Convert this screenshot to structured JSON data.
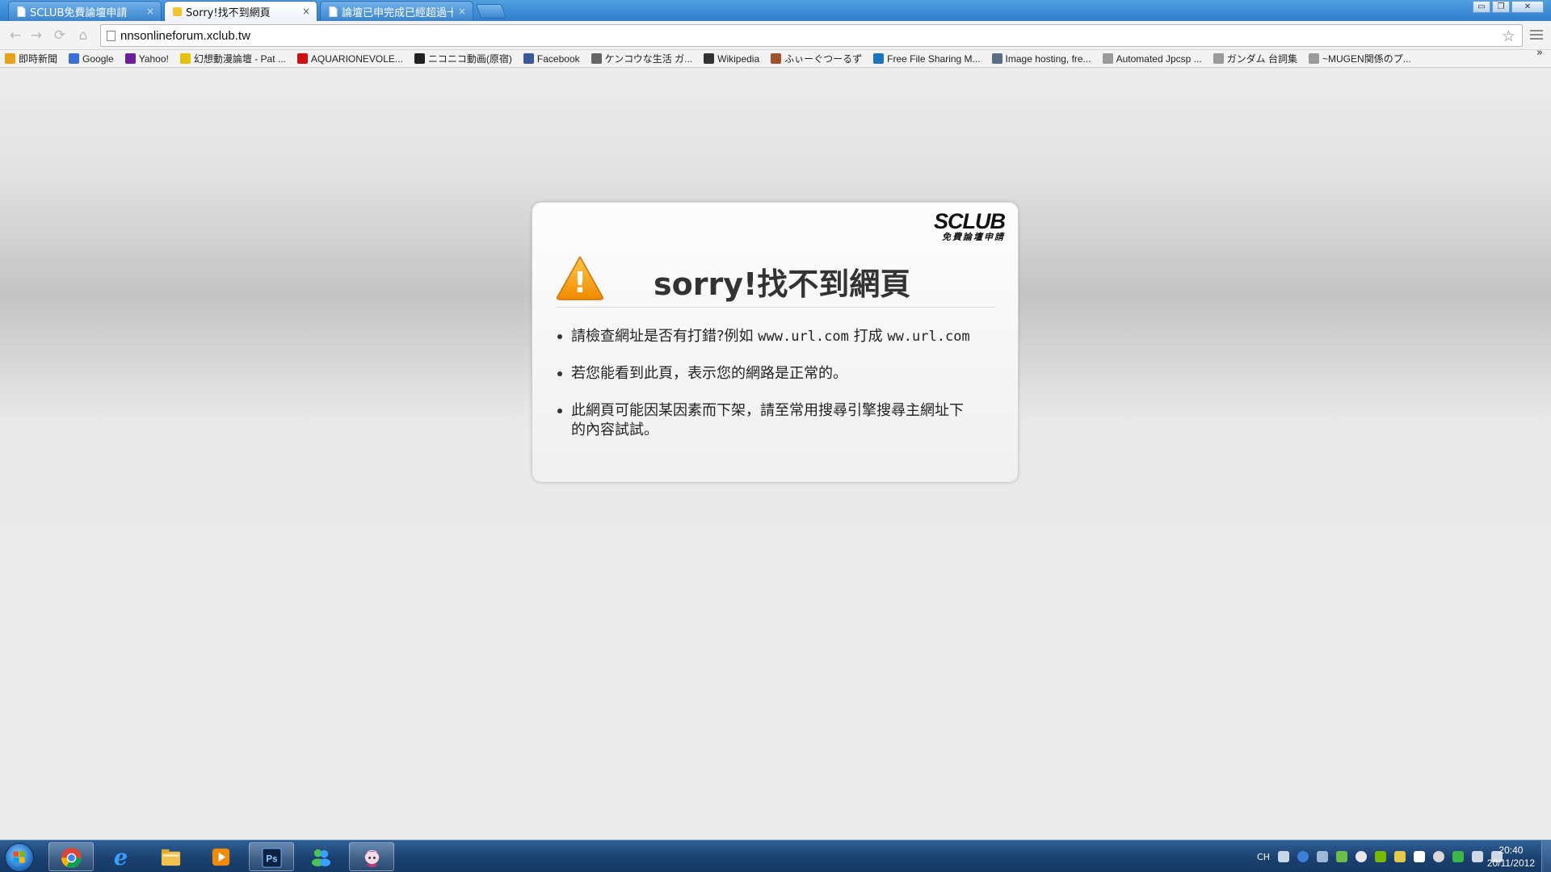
{
  "browser": {
    "tabs": [
      {
        "title": "SCLUB免費論壇申請",
        "active": false
      },
      {
        "title": "Sorry!找不到網頁",
        "active": true
      },
      {
        "title": "論壇已申完成已經超過十",
        "active": false
      }
    ],
    "close_glyph": "×",
    "window_controls": {
      "minimize": "▭",
      "restore": "❐",
      "close": "✕"
    },
    "url": "nnsonlineforum.xclub.tw",
    "bookmarks": [
      {
        "label": "即時新聞",
        "icon": "folder-icon",
        "color": "#e8a317"
      },
      {
        "label": "Google",
        "icon": "google-icon",
        "color": "#3a6fd8"
      },
      {
        "label": "Yahoo!",
        "icon": "yahoo-icon",
        "color": "#6b1f9b"
      },
      {
        "label": "幻想動漫論壇 - Pat ...",
        "icon": "forum-icon",
        "color": "#e6c200"
      },
      {
        "label": "AQUARIONEVOLE...",
        "icon": "youtube-icon",
        "color": "#d01010"
      },
      {
        "label": "ニコニコ動画(原宿)",
        "icon": "niconico-icon",
        "color": "#222222"
      },
      {
        "label": "Facebook",
        "icon": "facebook-icon",
        "color": "#3b5998"
      },
      {
        "label": "ケンコウな生活 ガ...",
        "icon": "kenkou-icon",
        "color": "#666666"
      },
      {
        "label": "Wikipedia",
        "icon": "wikipedia-icon",
        "color": "#333333"
      },
      {
        "label": "ふぃーぐつーるず",
        "icon": "figure-icon",
        "color": "#a0522d"
      },
      {
        "label": "Free File Sharing M...",
        "icon": "filesharing-icon",
        "color": "#1e73be"
      },
      {
        "label": "Image hosting, fre...",
        "icon": "imagehost-icon",
        "color": "#5a6f86"
      },
      {
        "label": "Automated Jpcsp ...",
        "icon": "page-icon",
        "color": "#9a9a9a"
      },
      {
        "label": "ガンダム 台詞集",
        "icon": "page-icon",
        "color": "#9a9a9a"
      },
      {
        "label": "~MUGEN関係のプ...",
        "icon": "page-icon",
        "color": "#9a9a9a"
      }
    ],
    "bookmarks_more": "»"
  },
  "error_card": {
    "logo_main": "SCLUB",
    "logo_sub": "免費論壇申請",
    "headline": "sorry!找不到網頁",
    "items": [
      {
        "prefix": "請檢查網址是否有打錯?例如 ",
        "url_a": "www.url.com",
        "mid": " 打成 ",
        "url_b": "ww.url.com"
      },
      {
        "text": "若您能看到此頁，表示您的網路是正常的。"
      },
      {
        "text": "此網頁可能因某因素而下架，請至常用搜尋引擎搜尋主網址下的內容試試。"
      }
    ],
    "warning_glyph": "!"
  },
  "taskbar": {
    "apps": [
      {
        "name": "chrome",
        "running": true
      },
      {
        "name": "internet-explorer",
        "running": false
      },
      {
        "name": "file-explorer",
        "running": false
      },
      {
        "name": "media-player",
        "running": false
      },
      {
        "name": "photoshop",
        "running": true,
        "label": "Ps"
      },
      {
        "name": "messenger",
        "running": false
      },
      {
        "name": "anime-app",
        "running": true
      }
    ],
    "tray_lang": "CH",
    "time": "20:40",
    "date": "20/11/2012"
  }
}
